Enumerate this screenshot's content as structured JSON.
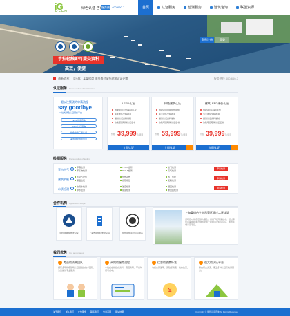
{
  "header": {
    "brand": "iG",
    "brand_sub": "REEN",
    "site_title": "绿色认证·咨询",
    "badge": "服务热线",
    "phone": "400-660-7",
    "nav": [
      {
        "label": "首页",
        "active": true
      },
      {
        "label": "认证服务",
        "active": false
      },
      {
        "label": "检测服务",
        "active": false
      },
      {
        "label": "建筑咨询",
        "active": false
      },
      {
        "label": "联盟资源",
        "active": false
      }
    ]
  },
  "banner": {
    "cta": "手拍轻触即可提交资料",
    "sub": "高效，便捷",
    "tab_left": "免费注册",
    "tab_right": "登录"
  },
  "notice": {
    "text": "最新消息：【上海】某某楼盘 项目通过绿色建筑认证评审",
    "right": "服务热线 400-660-7"
  },
  "sections": {
    "cert": {
      "title": "认证服务",
      "en": "Prerequisites of certification"
    },
    "test": {
      "title": "检测服务",
      "en": "Prerequisites of testing"
    },
    "partners": {
      "title": "合作机构",
      "en": "Application scope"
    },
    "why": {
      "title": "我们优势",
      "en": "Our advantages"
    }
  },
  "cert_left": {
    "small": "跟以往繁琐的申请流程",
    "big": "say goodbye",
    "sub": "一站式绿色认证服务平台",
    "pills": [
      "LEED认证咨询",
      "WELL认证咨询",
      "绿色建筑三星认证",
      "美国绿建协会会员"
    ]
  },
  "plans": [
    {
      "name": "LEED认证",
      "features": [
        "协助项目注册LEED认证",
        "专业团队全程跟进",
        "提供认证资料编制",
        "协助项目取得认证证书"
      ],
      "pre": "价格",
      "price": "39,999",
      "unit": "元/项目",
      "buy": "立即认证"
    },
    {
      "name": "绿色建筑认证",
      "features": [
        "协助项目申报绿色建筑",
        "专业团队全程跟进",
        "提供认证资料编制",
        "协助项目取得认证证书"
      ],
      "pre": "价格",
      "price": "59,999",
      "unit": "元/项目",
      "buy": "立即认证"
    },
    {
      "name": "建筑LEED评价认证",
      "features": [
        "协助项目LEED评价",
        "专业团队全程跟进",
        "提供认证资料编制",
        "协助项目取得认证证书"
      ],
      "pre": "价格",
      "price": "39,999",
      "unit": "元/项目",
      "buy": "立即认证"
    }
  ],
  "testing": {
    "rows": [
      {
        "cat": "室内空气",
        "items": [
          "甲醛检测",
          "苯系物检测",
          "TVOC检测",
          "PM2.5检测",
          "氨气检测",
          "氡气检测"
        ],
        "apply": "申请检测"
      },
      {
        "cat": "建筑节能",
        "items": [
          "外窗气密性",
          "保温性能",
          "传热系数",
          "遮阳系数",
          "热工性能",
          "能耗检测"
        ],
        "apply": "申请检测"
      },
      {
        "cat": "水质检测",
        "items": [
          "饮用水检测",
          "中水检测",
          "浊度检测",
          "余氯检测",
          "细菌检测",
          "重金属检测"
        ],
        "apply": "申请检测"
      }
    ]
  },
  "partners": {
    "cards": [
      {
        "label": "中国建筑科学研究院"
      },
      {
        "label": "上海市建筑科学研究院"
      },
      {
        "label": "绿色建筑评价标识中心"
      }
    ],
    "feature_title": "上海某绿色生态示范区通过二星认证",
    "feature_desc": "该项目以绿色低碳为理念，采用节能环保技术，经过专家评审顺利通过绿色建筑二星级设计标识认证，成为区域示范项目。"
  },
  "why": [
    {
      "title": "专业的技术团队",
      "text": "拥有多年绿色建筑认证经验的技术团队，为您提供专业服务。"
    },
    {
      "title": "高效的服务流程",
      "text": "一站式在线提交资料，流程清晰，节省时间与成本。"
    },
    {
      "title": "优惠的收费标准",
      "text": "收费公开透明，无隐形消费，性价比高。"
    },
    {
      "title": "强大的认证平台",
      "text": "整合行业资源，覆盖多种认证与检测服务。"
    }
  ],
  "footer": {
    "links": [
      "关于我们",
      "加入我们",
      "广告服务",
      "联系我们",
      "免责声明",
      "网站地图"
    ],
    "copy": "Copyright © 绿色认证咨询 All Rights Reserved"
  },
  "colors": {
    "primary": "#1c6fd0",
    "accent": "#e8332b",
    "orange": "#ff8a00",
    "green": "#8cc63f"
  }
}
